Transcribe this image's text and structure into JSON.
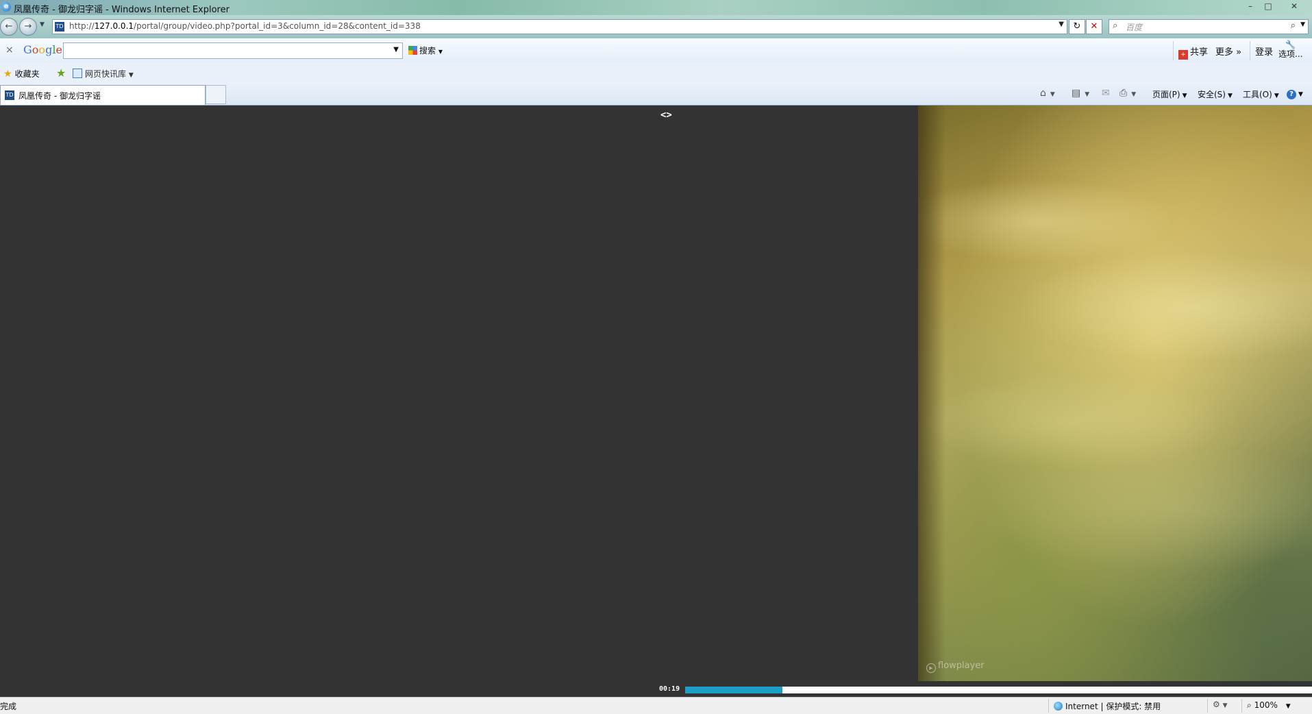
{
  "window": {
    "title": "凤凰传奇 - 御龙归字谣 - Windows Internet Explorer",
    "minimize_icon": "minimize-icon",
    "maximize_icon": "maximize-icon",
    "close_icon": "close-icon"
  },
  "address_bar": {
    "url_prefix": "http://",
    "url_host": "127.0.0.1",
    "url_path": "/portal/group/video.php?portal_id=3&column_id=28&content_id=338",
    "search_placeholder": "百度"
  },
  "google_toolbar": {
    "close_label": "×",
    "logo": "Google",
    "search_value": "",
    "search_button": "搜索",
    "share_label": "共享",
    "more_label": "更多 »",
    "login_label": "登录",
    "options_label": "选项..."
  },
  "favorites_bar": {
    "favorites_label": "收藏夹",
    "web_slice_label": "网页快讯库"
  },
  "tabs": [
    {
      "label": "凤凰传奇 - 御龙归字谣",
      "active": true
    }
  ],
  "command_bar": {
    "page_menu": "页面(P)",
    "safety_menu": "安全(S)",
    "tools_menu": "工具(O)",
    "help_label": "?"
  },
  "player": {
    "resize_handle": "<>",
    "current_time": "00:19",
    "progress_fraction": 0.155,
    "watermark": "flowplayer",
    "progress_color": "#1d9ec7"
  },
  "status_bar": {
    "status_text": "完成",
    "zone_text": "Internet | 保护模式: 禁用",
    "zoom_text": "100%"
  }
}
